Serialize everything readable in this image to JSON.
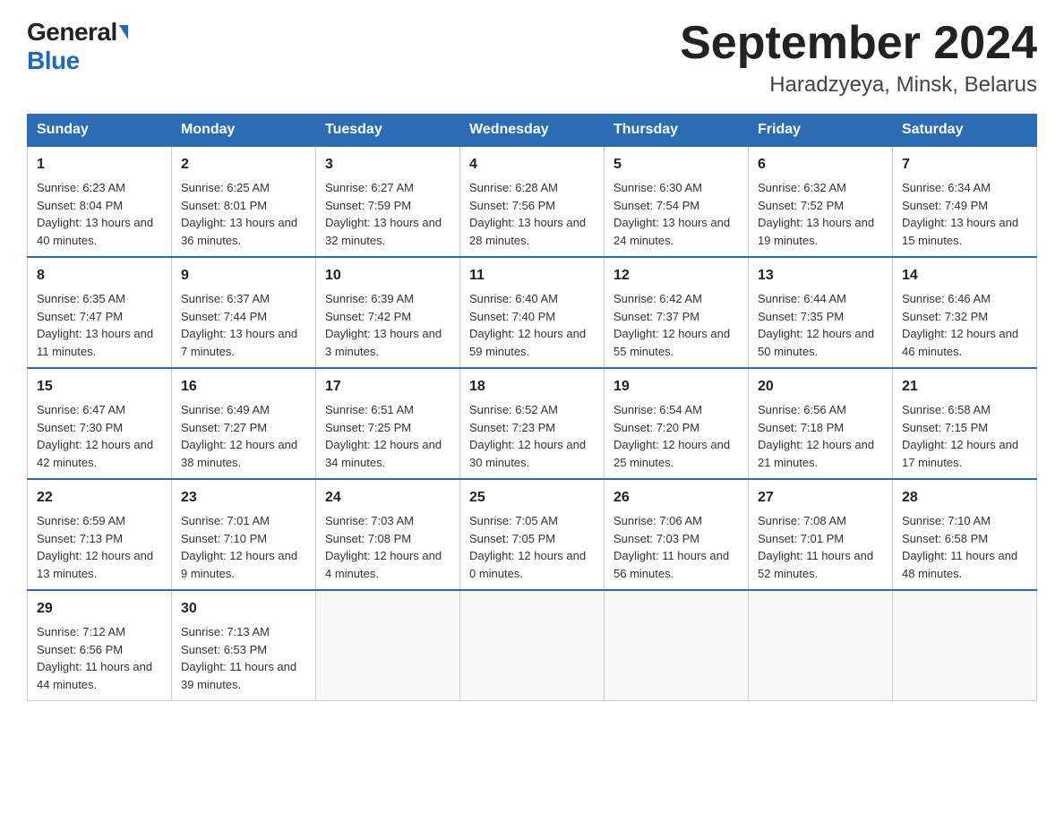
{
  "logo": {
    "general": "General",
    "blue": "Blue"
  },
  "title": {
    "month_year": "September 2024",
    "location": "Haradzyeya, Minsk, Belarus"
  },
  "headers": [
    "Sunday",
    "Monday",
    "Tuesday",
    "Wednesday",
    "Thursday",
    "Friday",
    "Saturday"
  ],
  "weeks": [
    [
      {
        "day": "1",
        "sunrise": "6:23 AM",
        "sunset": "8:04 PM",
        "daylight": "13 hours and 40 minutes."
      },
      {
        "day": "2",
        "sunrise": "6:25 AM",
        "sunset": "8:01 PM",
        "daylight": "13 hours and 36 minutes."
      },
      {
        "day": "3",
        "sunrise": "6:27 AM",
        "sunset": "7:59 PM",
        "daylight": "13 hours and 32 minutes."
      },
      {
        "day": "4",
        "sunrise": "6:28 AM",
        "sunset": "7:56 PM",
        "daylight": "13 hours and 28 minutes."
      },
      {
        "day": "5",
        "sunrise": "6:30 AM",
        "sunset": "7:54 PM",
        "daylight": "13 hours and 24 minutes."
      },
      {
        "day": "6",
        "sunrise": "6:32 AM",
        "sunset": "7:52 PM",
        "daylight": "13 hours and 19 minutes."
      },
      {
        "day": "7",
        "sunrise": "6:34 AM",
        "sunset": "7:49 PM",
        "daylight": "13 hours and 15 minutes."
      }
    ],
    [
      {
        "day": "8",
        "sunrise": "6:35 AM",
        "sunset": "7:47 PM",
        "daylight": "13 hours and 11 minutes."
      },
      {
        "day": "9",
        "sunrise": "6:37 AM",
        "sunset": "7:44 PM",
        "daylight": "13 hours and 7 minutes."
      },
      {
        "day": "10",
        "sunrise": "6:39 AM",
        "sunset": "7:42 PM",
        "daylight": "13 hours and 3 minutes."
      },
      {
        "day": "11",
        "sunrise": "6:40 AM",
        "sunset": "7:40 PM",
        "daylight": "12 hours and 59 minutes."
      },
      {
        "day": "12",
        "sunrise": "6:42 AM",
        "sunset": "7:37 PM",
        "daylight": "12 hours and 55 minutes."
      },
      {
        "day": "13",
        "sunrise": "6:44 AM",
        "sunset": "7:35 PM",
        "daylight": "12 hours and 50 minutes."
      },
      {
        "day": "14",
        "sunrise": "6:46 AM",
        "sunset": "7:32 PM",
        "daylight": "12 hours and 46 minutes."
      }
    ],
    [
      {
        "day": "15",
        "sunrise": "6:47 AM",
        "sunset": "7:30 PM",
        "daylight": "12 hours and 42 minutes."
      },
      {
        "day": "16",
        "sunrise": "6:49 AM",
        "sunset": "7:27 PM",
        "daylight": "12 hours and 38 minutes."
      },
      {
        "day": "17",
        "sunrise": "6:51 AM",
        "sunset": "7:25 PM",
        "daylight": "12 hours and 34 minutes."
      },
      {
        "day": "18",
        "sunrise": "6:52 AM",
        "sunset": "7:23 PM",
        "daylight": "12 hours and 30 minutes."
      },
      {
        "day": "19",
        "sunrise": "6:54 AM",
        "sunset": "7:20 PM",
        "daylight": "12 hours and 25 minutes."
      },
      {
        "day": "20",
        "sunrise": "6:56 AM",
        "sunset": "7:18 PM",
        "daylight": "12 hours and 21 minutes."
      },
      {
        "day": "21",
        "sunrise": "6:58 AM",
        "sunset": "7:15 PM",
        "daylight": "12 hours and 17 minutes."
      }
    ],
    [
      {
        "day": "22",
        "sunrise": "6:59 AM",
        "sunset": "7:13 PM",
        "daylight": "12 hours and 13 minutes."
      },
      {
        "day": "23",
        "sunrise": "7:01 AM",
        "sunset": "7:10 PM",
        "daylight": "12 hours and 9 minutes."
      },
      {
        "day": "24",
        "sunrise": "7:03 AM",
        "sunset": "7:08 PM",
        "daylight": "12 hours and 4 minutes."
      },
      {
        "day": "25",
        "sunrise": "7:05 AM",
        "sunset": "7:05 PM",
        "daylight": "12 hours and 0 minutes."
      },
      {
        "day": "26",
        "sunrise": "7:06 AM",
        "sunset": "7:03 PM",
        "daylight": "11 hours and 56 minutes."
      },
      {
        "day": "27",
        "sunrise": "7:08 AM",
        "sunset": "7:01 PM",
        "daylight": "11 hours and 52 minutes."
      },
      {
        "day": "28",
        "sunrise": "7:10 AM",
        "sunset": "6:58 PM",
        "daylight": "11 hours and 48 minutes."
      }
    ],
    [
      {
        "day": "29",
        "sunrise": "7:12 AM",
        "sunset": "6:56 PM",
        "daylight": "11 hours and 44 minutes."
      },
      {
        "day": "30",
        "sunrise": "7:13 AM",
        "sunset": "6:53 PM",
        "daylight": "11 hours and 39 minutes."
      },
      null,
      null,
      null,
      null,
      null
    ]
  ]
}
